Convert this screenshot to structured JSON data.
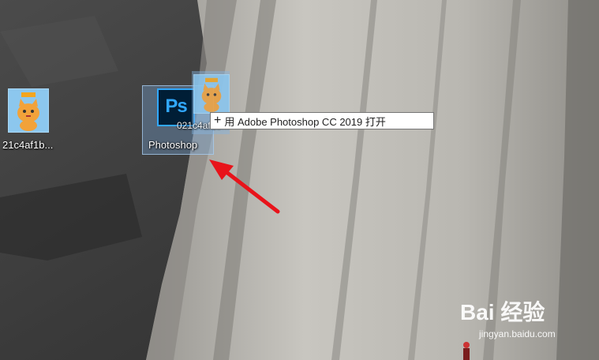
{
  "desktop": {
    "icons": [
      {
        "label": "21c4af1b...",
        "icon": "cat-image-icon"
      },
      {
        "label": "Photoshop",
        "icon": "photoshop-icon",
        "logo_text": "Ps"
      }
    ],
    "drag_ghost_label": "021c4af1b..."
  },
  "tooltip": {
    "icon": "plus-icon",
    "plus": "+",
    "text": "用 Adobe Photoshop CC 2019 打开"
  },
  "annotation": {
    "arrow_color": "#e8131a"
  },
  "watermark": {
    "brand": "Bai 经验",
    "url": "jingyan.baidu.com"
  }
}
